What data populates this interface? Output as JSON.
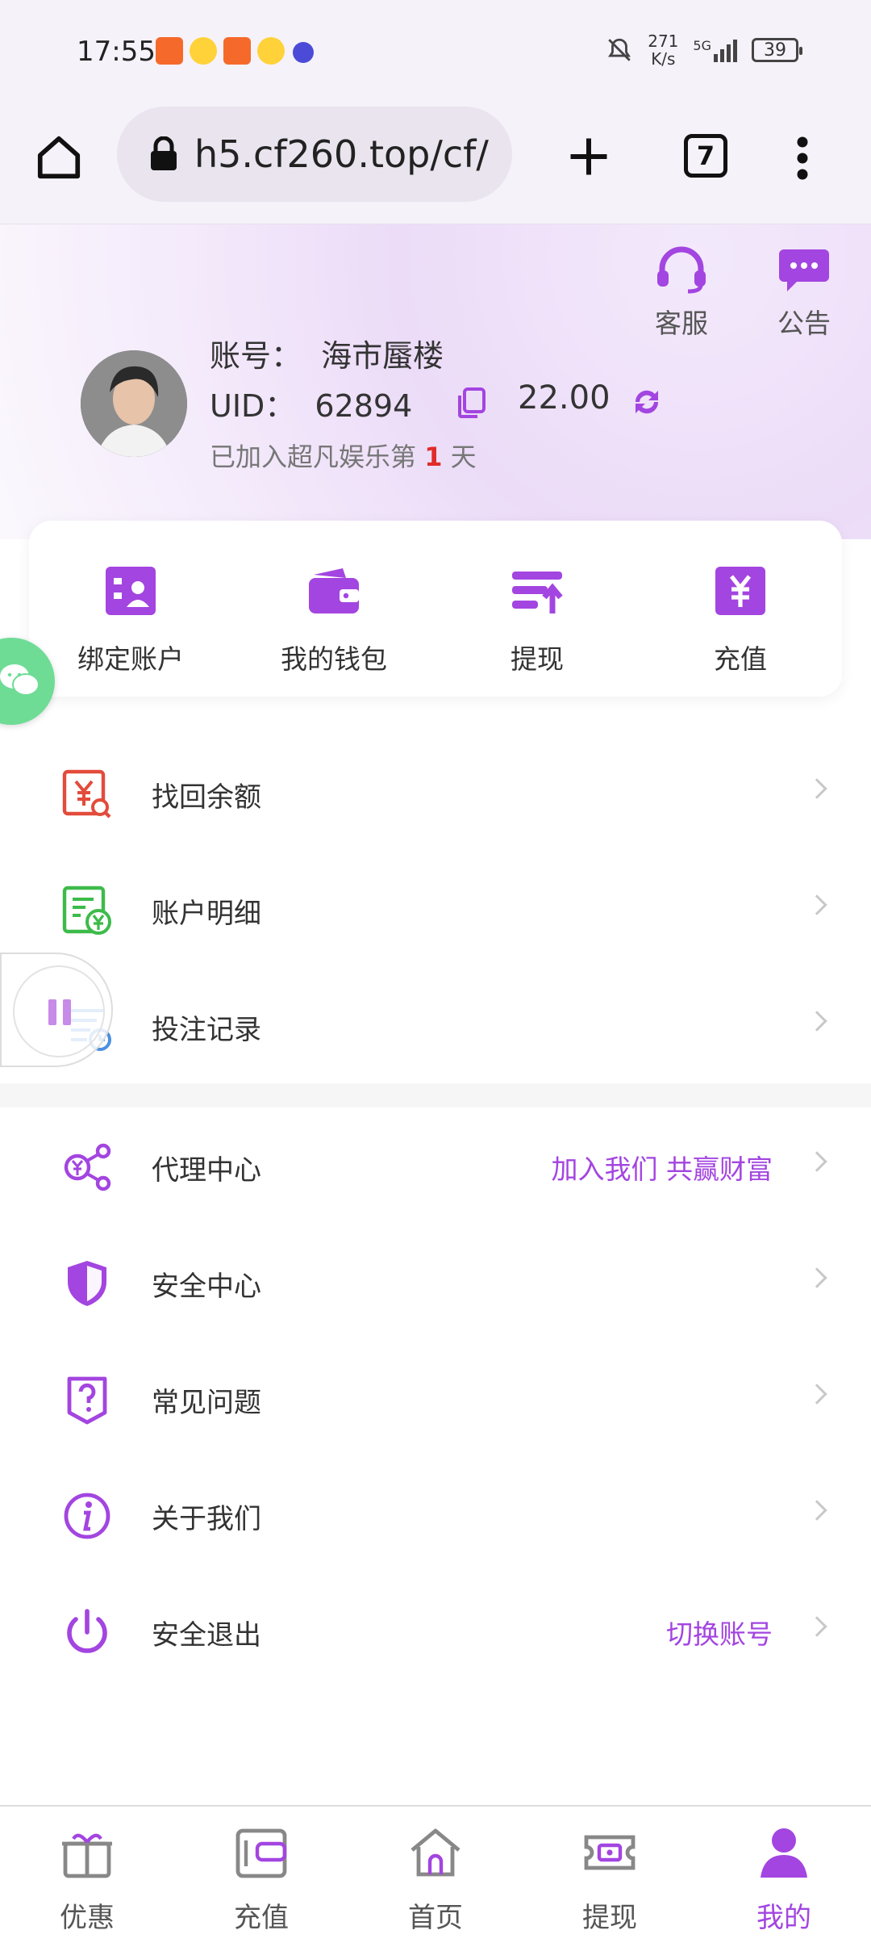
{
  "status_bar": {
    "time": "17:55",
    "speed_value": "271",
    "speed_unit": "K/s",
    "network": "5G",
    "battery": "39"
  },
  "browser": {
    "url": "h5.cf260.top/cf/",
    "tab_count": "7"
  },
  "header": {
    "service_label": "客服",
    "notice_label": "公告",
    "account_label": "账号：",
    "account_value": "海市蜃楼",
    "uid_label": "UID：",
    "uid_value": "62894",
    "balance": "22.00",
    "joined_prefix": "已加入超凡娱乐第",
    "joined_days": "1",
    "joined_suffix": "天"
  },
  "quick_actions": [
    {
      "label": "绑定账户",
      "icon": "bind-account-icon"
    },
    {
      "label": "我的钱包",
      "icon": "wallet-icon"
    },
    {
      "label": "提现",
      "icon": "withdraw-icon"
    },
    {
      "label": "充值",
      "icon": "recharge-icon"
    }
  ],
  "menu_group1": [
    {
      "label": "找回余额",
      "icon": "recover-balance-icon"
    },
    {
      "label": "账户明细",
      "icon": "account-detail-icon"
    },
    {
      "label": "投注记录",
      "icon": "bet-record-icon"
    }
  ],
  "menu_group2": [
    {
      "label": "代理中心",
      "extra": "加入我们 共赢财富",
      "icon": "agent-center-icon"
    },
    {
      "label": "安全中心",
      "extra": "",
      "icon": "shield-icon"
    },
    {
      "label": "常见问题",
      "extra": "",
      "icon": "question-icon"
    },
    {
      "label": "关于我们",
      "extra": "",
      "icon": "info-icon"
    },
    {
      "label": "安全退出",
      "extra": "切换账号",
      "icon": "power-icon"
    }
  ],
  "bottom_nav": [
    {
      "label": "优惠",
      "icon": "gift-icon"
    },
    {
      "label": "充值",
      "icon": "recharge-card-icon"
    },
    {
      "label": "首页",
      "icon": "home-icon"
    },
    {
      "label": "提现",
      "icon": "ticket-icon"
    },
    {
      "label": "我的",
      "icon": "user-icon",
      "active": true
    }
  ],
  "colors": {
    "accent": "#a345e0",
    "header_bg": "#ecdcf8",
    "danger": "#e02c2c",
    "green": "#3dbb4a",
    "red_icon": "#e34b3b"
  }
}
